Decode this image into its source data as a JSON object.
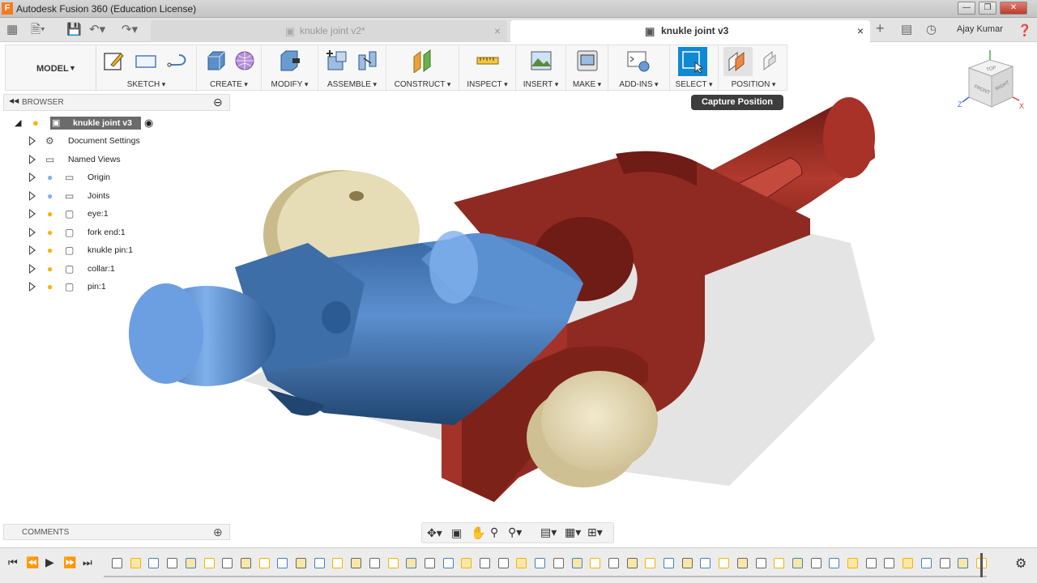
{
  "window": {
    "title": "Autodesk Fusion 360 (Education License)",
    "app_logo": "F"
  },
  "tabs": [
    {
      "label": "knukle joint v2*",
      "active": false
    },
    {
      "label": "knukle joint v3",
      "active": true
    }
  ],
  "user": {
    "name": "Ajay Kumar"
  },
  "toolbar": {
    "workspace": "MODEL",
    "groups": [
      {
        "label": "SKETCH"
      },
      {
        "label": "CREATE"
      },
      {
        "label": "MODIFY"
      },
      {
        "label": "ASSEMBLE"
      },
      {
        "label": "CONSTRUCT"
      },
      {
        "label": "INSPECT"
      },
      {
        "label": "INSERT"
      },
      {
        "label": "MAKE"
      },
      {
        "label": "ADD-INS"
      },
      {
        "label": "SELECT"
      },
      {
        "label": "POSITION"
      }
    ]
  },
  "tooltip": {
    "text": "Capture Position"
  },
  "browser": {
    "title": "BROWSER",
    "root": "knukle joint v3",
    "items": [
      {
        "label": "Document Settings",
        "icon": "gear-icon"
      },
      {
        "label": "Named Views",
        "icon": "folder-icon"
      },
      {
        "label": "Origin",
        "icon": "folder-icon"
      },
      {
        "label": "Joints",
        "icon": "folder-icon"
      },
      {
        "label": "eye:1",
        "icon": "component-icon"
      },
      {
        "label": "fork end:1",
        "icon": "component-icon"
      },
      {
        "label": "knukle pin:1",
        "icon": "component-icon"
      },
      {
        "label": "collar:1",
        "icon": "component-icon"
      },
      {
        "label": "pin:1",
        "icon": "component-icon"
      }
    ]
  },
  "comments": {
    "title": "COMMENTS"
  },
  "viewcube": {
    "top": "TOP",
    "front": "FRONT",
    "right": "RIGHT",
    "axis_z": "Z",
    "axis_x": "X"
  },
  "colors": {
    "fork": "#8f2a22",
    "eye": "#3d6fa8",
    "collar": "#e3d7a8",
    "accent": "#0f89d6"
  }
}
